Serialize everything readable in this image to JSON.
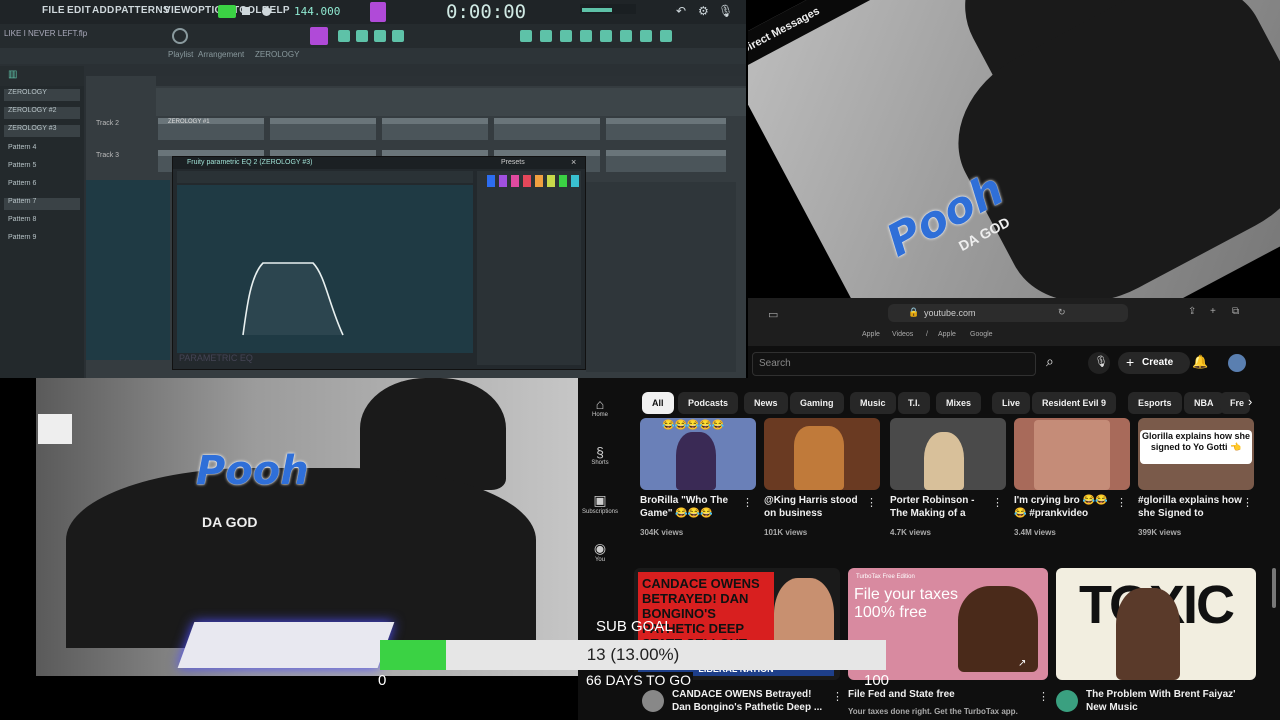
{
  "fl": {
    "menu": [
      "FILE",
      "EDIT",
      "ADD",
      "PATTERNS",
      "VIEW",
      "OPTIONS",
      "TOOLS",
      "HELP"
    ],
    "tempo": "144.000",
    "time": "0:00:00",
    "project_name": "LIKE I NEVER LEFT.flp",
    "playlist_breadcrumb": [
      "Playlist",
      "Arrangement",
      "ZEROLOGY"
    ],
    "browser_items": [
      "ZEROLOGY",
      "ZEROLOGY #2",
      "ZEROLOGY #3",
      "Pattern 4",
      "Pattern 5",
      "Pattern 6",
      "Pattern 7",
      "Pattern 8",
      "Pattern 9"
    ],
    "tracks": [
      "Track 2",
      "Track 3"
    ],
    "clip_label": "ZEROLOGY #1",
    "eq_title": "Fruity parametric EQ 2 (ZEROLOGY #3)",
    "eq_footer": "PARAMETRIC EQ",
    "presets_label": "Presets",
    "mixer_colors": [
      "#2d6df0",
      "#a050e0",
      "#e04aa0",
      "#e4475a",
      "#f0a040",
      "#c8d84a",
      "#3bd244",
      "#39c0d0"
    ]
  },
  "cam_top": {
    "header": "Direct Messages",
    "logo": "Pooh",
    "logo_sub": "DA GOD"
  },
  "cam_bottom": {
    "logo": "Pooh",
    "logo_sub": "DA GOD"
  },
  "safari": {
    "url": "youtube.com",
    "bookmarks": [
      "Apple",
      "Videos",
      "/",
      "Apple",
      "Google"
    ]
  },
  "youtube": {
    "search_placeholder": "Search",
    "create_label": "Create",
    "chips": [
      "All",
      "Podcasts",
      "News",
      "Gaming",
      "Music",
      "T.I.",
      "Mixes",
      "Live",
      "Resident Evil 9",
      "Esports",
      "NBA",
      "Fre"
    ],
    "nav": [
      "Home",
      "Shorts",
      "Subscriptions",
      "You"
    ],
    "shorts": [
      {
        "title": "BroRilla \"Who The Game\" 😂😂😂",
        "views": "304K views",
        "emoji": "😂😂😂😂😂"
      },
      {
        "title": "@King Harris stood on business",
        "views": "101K views"
      },
      {
        "title": "Porter Robinson - The Making of a",
        "views": "4.7K views"
      },
      {
        "title": "I'm crying bro 😂😂😂 #prankvideo",
        "views": "3.4M views"
      },
      {
        "title": "#glorilla explains how she Signed to",
        "views": "399K views",
        "overlay": "Glorilla explains how she signed to Yo Gotti 👈"
      }
    ],
    "videos": [
      {
        "title": "CANDACE OWENS Betrayed! Dan Bongino's Pathetic Deep ...",
        "thumb_text": "CANDACE OWENS BETRAYED! DAN BONGINO'S PATHETIC DEEP STATE SELLOUT",
        "channel": "LIBERAL NATION"
      },
      {
        "title": "File Fed and State free",
        "sub": "Your taxes done right. Get the TurboTax app.",
        "thumb_text": "File your taxes 100% free",
        "sponsor": "TurboTax Free Edition"
      },
      {
        "title": "The Problem With Brent Faiyaz' New Music",
        "thumb_text": "TOXIC"
      }
    ]
  },
  "sub_goal": {
    "label": "SUB GOAL",
    "progress_text": "13 (13.00%)",
    "progress": 0.13,
    "start": "0",
    "end": "100",
    "days_left": "66 DAYS TO GO"
  }
}
